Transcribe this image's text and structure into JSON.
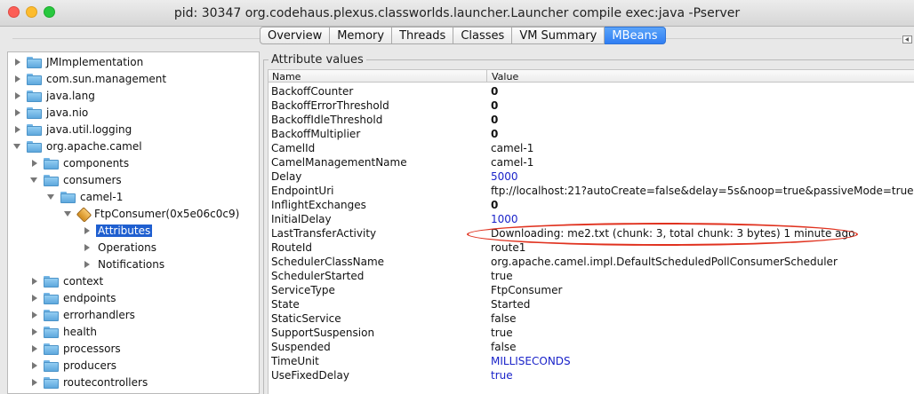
{
  "window": {
    "title": "pid: 30347 org.codehaus.plexus.classworlds.launcher.Launcher compile exec:java -Pserver"
  },
  "tabs": [
    {
      "label": "Overview",
      "active": false
    },
    {
      "label": "Memory",
      "active": false
    },
    {
      "label": "Threads",
      "active": false
    },
    {
      "label": "Classes",
      "active": false
    },
    {
      "label": "VM Summary",
      "active": false
    },
    {
      "label": "MBeans",
      "active": true
    }
  ],
  "tree": {
    "items": [
      {
        "label": "JMImplementation",
        "expanded": false
      },
      {
        "label": "com.sun.management",
        "expanded": false
      },
      {
        "label": "java.lang",
        "expanded": false
      },
      {
        "label": "java.nio",
        "expanded": false
      },
      {
        "label": "java.util.logging",
        "expanded": false
      },
      {
        "label": "org.apache.camel",
        "expanded": true
      },
      {
        "label": "components",
        "expanded": false
      },
      {
        "label": "consumers",
        "expanded": true
      },
      {
        "label": "camel-1",
        "expanded": true
      },
      {
        "label": "FtpConsumer(0x5e06c0c9)",
        "expanded": true
      },
      {
        "label": "Attributes",
        "selected": true
      },
      {
        "label": "Operations"
      },
      {
        "label": "Notifications"
      },
      {
        "label": "context",
        "expanded": false
      },
      {
        "label": "endpoints",
        "expanded": false
      },
      {
        "label": "errorhandlers",
        "expanded": false
      },
      {
        "label": "health",
        "expanded": false
      },
      {
        "label": "processors",
        "expanded": false
      },
      {
        "label": "producers",
        "expanded": false
      },
      {
        "label": "routecontrollers",
        "expanded": false
      }
    ]
  },
  "attributes": {
    "title": "Attribute values",
    "columns": {
      "name": "Name",
      "value": "Value"
    },
    "rows": [
      {
        "name": "BackoffCounter",
        "value": "0"
      },
      {
        "name": "BackoffErrorThreshold",
        "value": "0"
      },
      {
        "name": "BackoffIdleThreshold",
        "value": "0"
      },
      {
        "name": "BackoffMultiplier",
        "value": "0"
      },
      {
        "name": "CamelId",
        "value": "camel-1"
      },
      {
        "name": "CamelManagementName",
        "value": "camel-1"
      },
      {
        "name": "Delay",
        "value": "5000"
      },
      {
        "name": "EndpointUri",
        "value": "ftp://localhost:21?autoCreate=false&delay=5s&noop=true&passiveMode=true&..."
      },
      {
        "name": "InflightExchanges",
        "value": "0"
      },
      {
        "name": "InitialDelay",
        "value": "1000"
      },
      {
        "name": "LastTransferActivity",
        "value": "Downloading: me2.txt (chunk: 3, total chunk: 3 bytes) 1 minute ago"
      },
      {
        "name": "RouteId",
        "value": "route1"
      },
      {
        "name": "SchedulerClassName",
        "value": "org.apache.camel.impl.DefaultScheduledPollConsumerScheduler"
      },
      {
        "name": "SchedulerStarted",
        "value": "true"
      },
      {
        "name": "ServiceType",
        "value": "FtpConsumer"
      },
      {
        "name": "State",
        "value": "Started"
      },
      {
        "name": "StaticService",
        "value": "false"
      },
      {
        "name": "SupportSuspension",
        "value": "true"
      },
      {
        "name": "Suspended",
        "value": "false"
      },
      {
        "name": "TimeUnit",
        "value": "MILLISECONDS"
      },
      {
        "name": "UseFixedDelay",
        "value": "true"
      }
    ]
  },
  "colors": {
    "selection": "#1f5fd0",
    "link_value": "#1a23c9",
    "annotation": "#e0321f",
    "tab_active": "#2f7ef3"
  }
}
